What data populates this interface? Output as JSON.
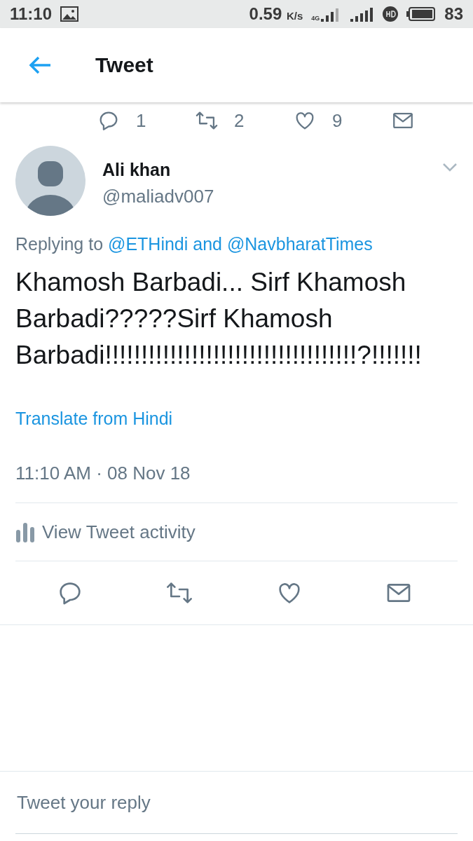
{
  "status_bar": {
    "time": "11:10",
    "speed": "0.59",
    "speed_unit": "K/s",
    "network": "4G",
    "battery": "83"
  },
  "header": {
    "title": "Tweet"
  },
  "parent_actions": [
    {
      "kind": "reply",
      "count": "1"
    },
    {
      "kind": "retweet",
      "count": "2"
    },
    {
      "kind": "like",
      "count": "9"
    },
    {
      "kind": "message"
    }
  ],
  "tweet": {
    "name": "Ali khan",
    "handle": "@maliadv007",
    "replying_prefix": "Replying to",
    "replying_to": "@ETHindi and @NavbharatTimes",
    "text": "Khamosh Barbadi... Sirf Khamosh Barbadi?????Sirf Khamosh Barbadi!!!!!!!!!!!!!!!!!!!!!!!!!!!!!!!!!!!?!!!!!!!",
    "translate": "Translate from Hindi",
    "timestamp": "11:10 AM · 08 Nov 18",
    "activity": "View Tweet activity"
  },
  "actions": [
    {
      "kind": "reply"
    },
    {
      "kind": "retweet"
    },
    {
      "kind": "like"
    },
    {
      "kind": "message"
    }
  ],
  "reply_box": {
    "placeholder": "Tweet your reply"
  }
}
